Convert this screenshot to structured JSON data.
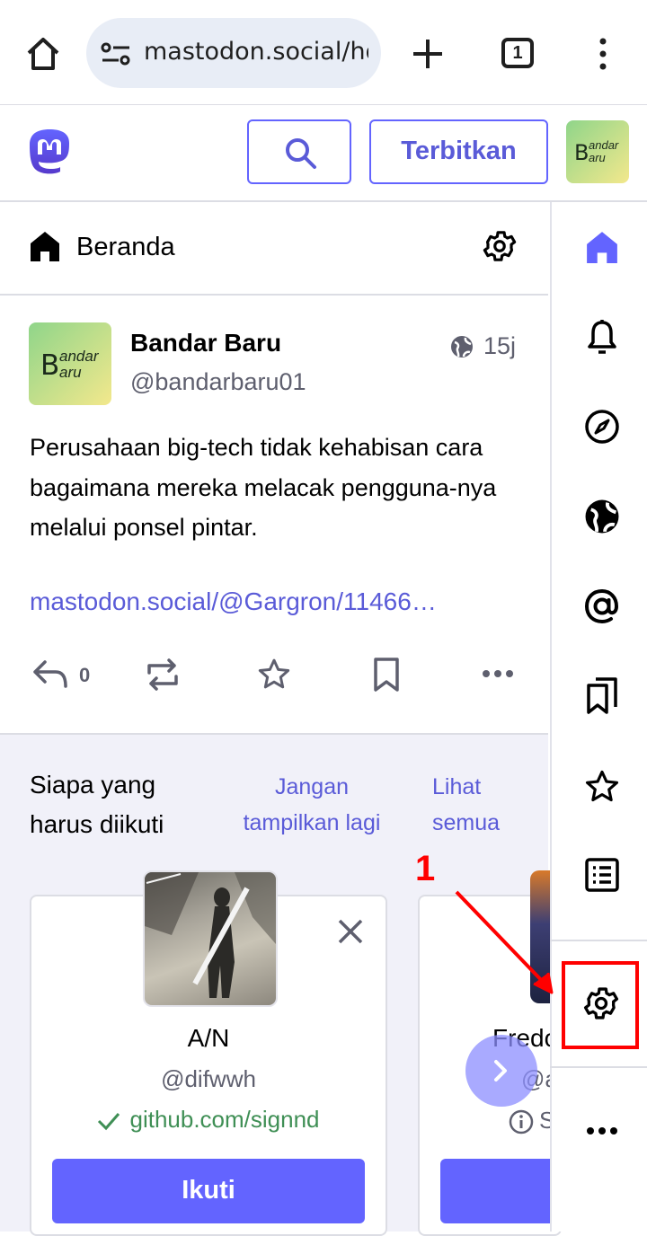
{
  "browser": {
    "url": "mastodon.social/ho",
    "tab_count": "1"
  },
  "app_header": {
    "publish_label": "Terbitkan",
    "avatar_text_main": "B",
    "avatar_text_sub1": "andar",
    "avatar_text_sub2": "aru"
  },
  "column": {
    "title": "Beranda"
  },
  "post": {
    "display_name": "Bandar Baru",
    "handle": "@bandarbaru01",
    "time": "15j",
    "body": "Perusahaan big-tech tidak kehabisan cara bagaimana mereka melacak pengguna-nya melalui ponsel pintar.",
    "link": "mastodon.social/@Gargron/11466…",
    "reply_count": "0"
  },
  "suggestions": {
    "title": "Siapa yang harus diikuti",
    "dismiss_label": "Jangan tampilkan lagi",
    "view_all_label": "Lihat semua",
    "cards": [
      {
        "name": "A/N",
        "handle": "@difwwh",
        "verified_link": "github.com/signnd",
        "follow_label": "Ikuti"
      },
      {
        "name": "Fredo",
        "handle": "@a",
        "meta": "S"
      }
    ]
  },
  "right_nav": [
    "home-icon",
    "bell-icon",
    "compass-icon",
    "globe-icon",
    "at-icon",
    "bookmarks-icon",
    "star-icon",
    "list-icon",
    "gear-icon",
    "more-icon"
  ],
  "annotation": {
    "number": "1",
    "color": "#ff0000"
  },
  "colors": {
    "accent": "#6364ff",
    "link": "#5a5bd8",
    "verified": "#3f8f55",
    "suggestion_bg": "#f1f1f9"
  }
}
